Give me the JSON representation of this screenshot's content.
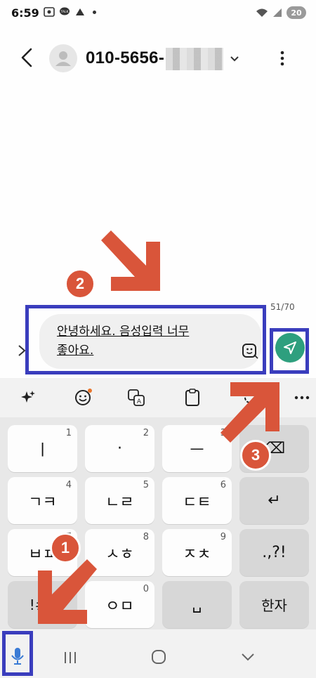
{
  "status_bar": {
    "time": "6:59",
    "battery": "20"
  },
  "header": {
    "contact_number": "010-5656-"
  },
  "composer": {
    "char_counter": "51/70",
    "message_line1": "안녕하세요. 음성입력 너무",
    "message_line2": "좋아요."
  },
  "keyboard": {
    "rows": [
      [
        {
          "label": "ㅣ",
          "num": "1"
        },
        {
          "label": "·",
          "num": "2"
        },
        {
          "label": "ㅡ",
          "num": "3"
        },
        {
          "label": "⌫",
          "num": ""
        }
      ],
      [
        {
          "label": "ㄱㅋ",
          "num": "4"
        },
        {
          "label": "ㄴㄹ",
          "num": "5"
        },
        {
          "label": "ㄷㅌ",
          "num": "6"
        },
        {
          "label": "↵",
          "num": ""
        }
      ],
      [
        {
          "label": "ㅂㅍ",
          "num": "7"
        },
        {
          "label": "ㅅㅎ",
          "num": "8"
        },
        {
          "label": "ㅈㅊ",
          "num": "9"
        },
        {
          "label": ".,?!",
          "num": ""
        }
      ],
      [
        {
          "label": "!#1",
          "num": ""
        },
        {
          "label": "ㅇㅁ",
          "num": "0"
        },
        {
          "label": "␣",
          "num": ""
        },
        {
          "label": "한자",
          "num": ""
        }
      ]
    ]
  },
  "annotations": {
    "step1": "1",
    "step2": "2",
    "step3": "3"
  },
  "colors": {
    "send": "#2e9f7e",
    "highlight": "#3a3dbd",
    "arrow": "#d9553a"
  }
}
